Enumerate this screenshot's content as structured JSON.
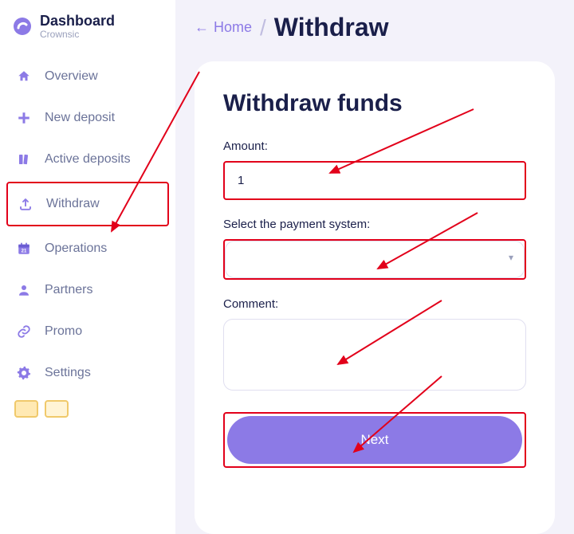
{
  "brand": {
    "title": "Dashboard",
    "subtitle": "Crownsic"
  },
  "sidebar": {
    "items": [
      {
        "label": "Overview"
      },
      {
        "label": "New deposit"
      },
      {
        "label": "Active deposits"
      },
      {
        "label": "Withdraw"
      },
      {
        "label": "Operations"
      },
      {
        "label": "Partners"
      },
      {
        "label": "Promo"
      },
      {
        "label": "Settings"
      }
    ]
  },
  "breadcrumb": {
    "home": "Home",
    "arrow": "←"
  },
  "page": {
    "title": "Withdraw"
  },
  "card": {
    "title": "Withdraw funds",
    "amount_label": "Amount:",
    "amount_value": "1",
    "payment_label": "Select the payment system:",
    "payment_value": "",
    "comment_label": "Comment:",
    "comment_value": "",
    "next_label": "Next"
  },
  "colors": {
    "accent": "#8c7ae6",
    "highlight": "#e2001a"
  }
}
